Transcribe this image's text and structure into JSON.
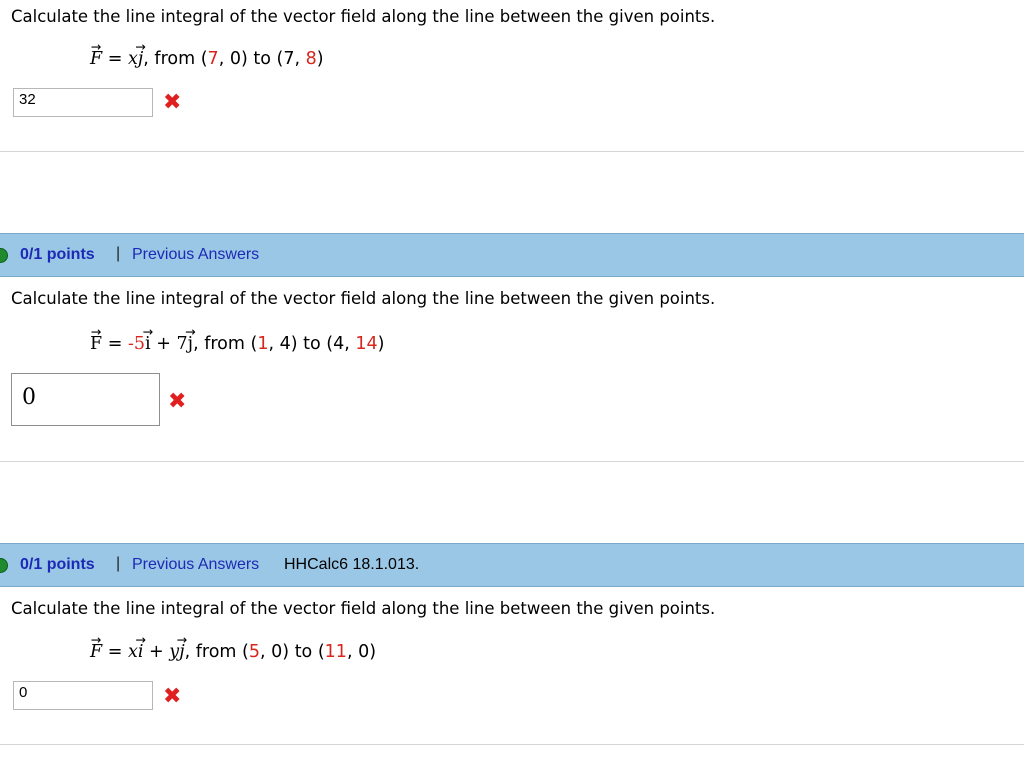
{
  "questions": [
    {
      "prompt": "Calculate the line integral of the vector field along the line between the given points.",
      "formula": {
        "field": "F",
        "equals": "=",
        "terms": [
          {
            "coef": "x",
            "unit": "j"
          }
        ],
        "from_word": ", from",
        "start": [
          "7",
          "0"
        ],
        "to_word": "to",
        "end": [
          "7",
          "8"
        ]
      },
      "answer_value": "32",
      "status_icon": "red-x-icon"
    },
    {
      "header": {
        "points": "0/1 points",
        "separator": "|",
        "previous": "Previous Answers",
        "code": ""
      },
      "prompt": "Calculate the line integral of the vector field along the line between the given points.",
      "formula": {
        "field": "F",
        "equals": "=",
        "terms": [
          {
            "coef": "-5",
            "unit": "i"
          },
          {
            "op": "+",
            "coef": "7",
            "unit": "j"
          }
        ],
        "from_word": ", from",
        "start": [
          "1",
          "4"
        ],
        "to_word": "to",
        "end": [
          "4",
          "14"
        ]
      },
      "answer_value": "0",
      "status_icon": "red-x-icon"
    },
    {
      "header": {
        "points": "0/1 points",
        "separator": "|",
        "previous": "Previous Answers",
        "code": "HHCalc6 18.1.013."
      },
      "prompt": "Calculate the line integral of the vector field along the line between the given points.",
      "formula": {
        "field": "F",
        "equals": "=",
        "terms": [
          {
            "coef": "x",
            "unit": "i"
          },
          {
            "op": "+",
            "coef": "y",
            "unit": "j"
          }
        ],
        "from_word": ", from",
        "start": [
          "5",
          "0"
        ],
        "to_word": "to",
        "end": [
          "11",
          "0"
        ]
      },
      "answer_value": "0",
      "status_icon": "red-x-icon"
    }
  ],
  "colors": {
    "highlight": "#d9261c",
    "band": "#9ac7e6",
    "link": "#1d2ab5",
    "wrong": "#e01f1f"
  }
}
